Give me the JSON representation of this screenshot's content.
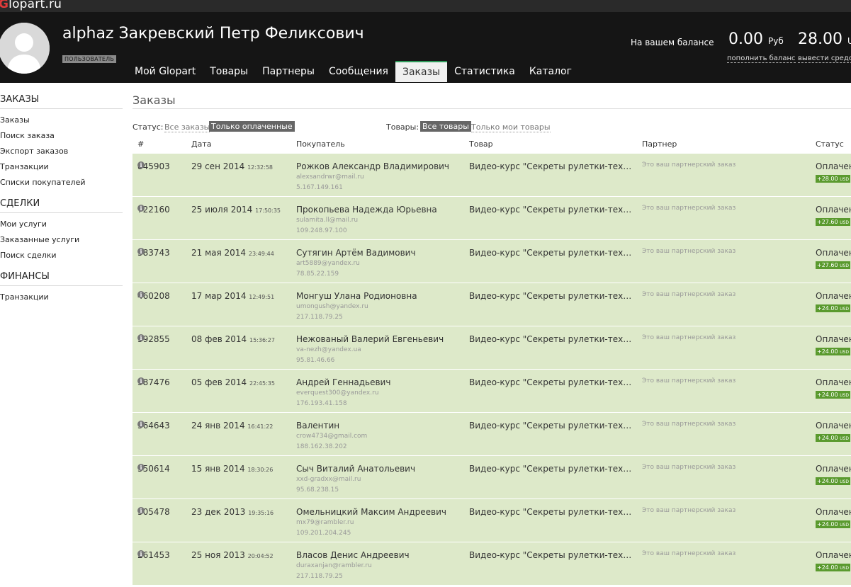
{
  "site": {
    "logo_first": "G",
    "logo_rest": "lopart.ru"
  },
  "user": {
    "name": "alphaz Закревский Петр Феликсович",
    "role": "ПОЛЬЗОВАТЕЛЬ"
  },
  "nav": [
    "Мой Glopart",
    "Товары",
    "Партнеры",
    "Сообщения",
    "Заказы",
    "Статистика",
    "Каталог"
  ],
  "nav_active": "Заказы",
  "balance": {
    "label": "На вашем балансе",
    "amount1": "0.00",
    "currency1": "Руб",
    "amount2": "28.00",
    "currency2": "US",
    "link_topup": "пополнить баланс",
    "link_withdraw": "вывести средс"
  },
  "sidebar": {
    "orders_head": "ЗАКАЗЫ",
    "orders_items": [
      "Заказы",
      "Поиск заказа",
      "Экспорт заказов",
      "Транзакции",
      "Списки покупателей"
    ],
    "deals_head": "СДЕЛКИ",
    "deals_items": [
      "Мои услуги",
      "Заказанные услуги",
      "Поиск сделки"
    ],
    "finance_head": "ФИНАНСЫ",
    "finance_items": [
      "Транзакции"
    ]
  },
  "main": {
    "title": "Заказы",
    "status_label": "Статус:",
    "status_all": "Все заказы",
    "status_paid": "Только оплаченные",
    "goods_label": "Товары:",
    "goods_all": "Все товары",
    "goods_mine": "Только мои товары"
  },
  "columns": [
    "#",
    "Дата",
    "Покупатель",
    "Товар",
    "Партнер",
    "Статус"
  ],
  "colors": {
    "row_bg": "#dde9c9",
    "amount_badge": "#5a9a2e",
    "header_bg": "#151515"
  },
  "orders": [
    {
      "id": "845903",
      "date": "29 сен 2014",
      "time": "12:32:58",
      "buyer": "Рожков Александр Владимирович",
      "email": "alexsandrwr@mail.ru",
      "ip": "5.167.149.161",
      "product": "Видео-курс \"Секреты рулетки-техн…",
      "partner": "Это ваш партнерский заказ",
      "status": "Оплачен",
      "amount": "+28.00",
      "currency": "USD"
    },
    {
      "id": "722160",
      "date": "25 июля 2014",
      "time": "17:50:35",
      "buyer": "Прокопьева Надежда Юрьевна",
      "email": "sulamita.ll@mail.ru",
      "ip": "109.248.97.100",
      "product": "Видео-курс \"Секреты рулетки-техн…",
      "partner": "Это ваш партнерский заказ",
      "status": "Оплачен",
      "amount": "+27.60",
      "currency": "USD"
    },
    {
      "id": "583743",
      "date": "21 мая 2014",
      "time": "23:49:44",
      "buyer": "Сутягин Артём Вадимович",
      "email": "art5889@yandex.ru",
      "ip": "78.85.22.159",
      "product": "Видео-курс \"Секреты рулетки-техн…",
      "partner": "Это ваш партнерский заказ",
      "status": "Оплачен",
      "amount": "+27.60",
      "currency": "USD"
    },
    {
      "id": "460208",
      "date": "17 мар 2014",
      "time": "12:49:51",
      "buyer": "Монгуш Улана Родионовна",
      "email": "umongush@yandex.ru",
      "ip": "217.118.79.25",
      "product": "Видео-курс \"Секреты рулетки-техн…",
      "partner": "Это ваш партнерский заказ",
      "status": "Оплачен",
      "amount": "+24.00",
      "currency": "USD"
    },
    {
      "id": "392855",
      "date": "08 фев 2014",
      "time": "15:36:27",
      "buyer": "Нежованый Валерий Евгеньевич",
      "email": "va-nezh@yandex.ua",
      "ip": "95.81.46.66",
      "product": "Видео-курс \"Секреты рулетки-техн…",
      "partner": "Это ваш партнерский заказ",
      "status": "Оплачен",
      "amount": "+24.00",
      "currency": "USD"
    },
    {
      "id": "387476",
      "date": "05 фев 2014",
      "time": "22:45:35",
      "buyer": "Андрей Геннадьевич",
      "email": "everquest300@yandex.ru",
      "ip": "176.193.41.158",
      "product": "Видео-курс \"Секреты рулетки-техн…",
      "partner": "Это ваш партнерский заказ",
      "status": "Оплачен",
      "amount": "+24.00",
      "currency": "USD"
    },
    {
      "id": "364643",
      "date": "24 янв 2014",
      "time": "16:41:22",
      "buyer": "Валентин",
      "email": "crow4734@gmail.com",
      "ip": "188.162.38.202",
      "product": "Видео-курс \"Секреты рулетки-техн…",
      "partner": "Это ваш партнерский заказ",
      "status": "Оплачен",
      "amount": "+24.00",
      "currency": "USD"
    },
    {
      "id": "350614",
      "date": "15 янв 2014",
      "time": "18:30:26",
      "buyer": "Сыч Виталий Анатольевич",
      "email": "xxd-gradxx@mail.ru",
      "ip": "95.68.238.15",
      "product": "Видео-курс \"Секреты рулетки-техн…",
      "partner": "Это ваш партнерский заказ",
      "status": "Оплачен",
      "amount": "+24.00",
      "currency": "USD"
    },
    {
      "id": "305478",
      "date": "23 дек 2013",
      "time": "19:35:16",
      "buyer": "Омельницкий Максим Андреевич",
      "email": "mx79@rambler.ru",
      "ip": "109.201.204.245",
      "product": "Видео-курс \"Секреты рулетки-техн…",
      "partner": "Это ваш партнерский заказ",
      "status": "Оплачен",
      "amount": "+24.00",
      "currency": "USD"
    },
    {
      "id": "261453",
      "date": "25 ноя 2013",
      "time": "20:04:52",
      "buyer": "Власов Денис Андреевич",
      "email": "duraxanjan@rambler.ru",
      "ip": "217.118.79.25",
      "product": "Видео-курс \"Секреты рулетки-техн…",
      "partner": "Это ваш партнерский заказ",
      "status": "Оплачен",
      "amount": "+24.00",
      "currency": "USD"
    }
  ]
}
